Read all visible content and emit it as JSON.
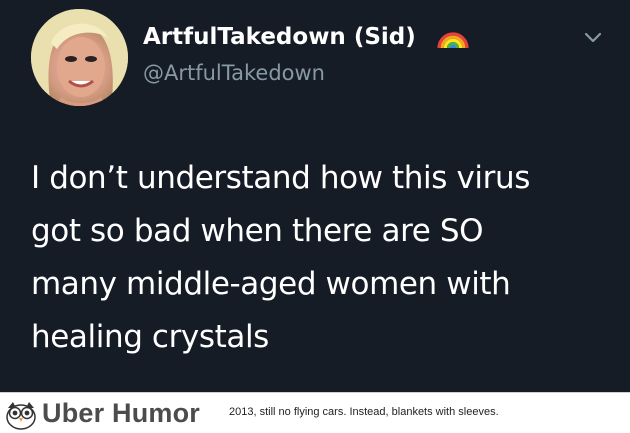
{
  "tweet": {
    "display_name": "ArtfulTakedown (Sid)",
    "handle": "@ArtfulTakedown",
    "text_lines": [
      "I don’t understand how this virus",
      "got so bad when there are SO",
      "many middle-aged women with",
      "healing crystals"
    ],
    "badge_icon": "rainbow-emoji-icon",
    "menu_icon": "chevron-down-icon",
    "colors": {
      "background": "#151c26",
      "name": "#ffffff",
      "handle": "#8899a6",
      "text": "#ffffff"
    }
  },
  "footer": {
    "brand": "Uber Humor",
    "caption": "2013, still no flying cars. Instead, blankets with sleeves.",
    "logo_icon": "owl-logo-icon"
  }
}
